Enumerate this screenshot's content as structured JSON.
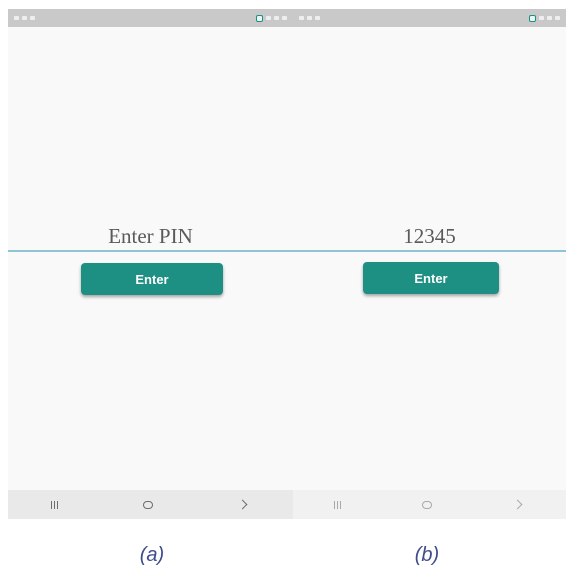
{
  "screens": [
    {
      "id": "a",
      "pin_field": {
        "placeholder": "Enter PIN",
        "value": ""
      },
      "enter_button": {
        "label": "Enter"
      },
      "caption": "(a)"
    },
    {
      "id": "b",
      "pin_field": {
        "placeholder": "Enter PIN",
        "value": "12345"
      },
      "enter_button": {
        "label": "Enter"
      },
      "caption": "(b)"
    }
  ],
  "nav_icons": [
    "recent-apps-icon",
    "home-icon",
    "back-icon"
  ],
  "colors": {
    "accent": "#1e8f83",
    "field_underline": "#8fc5d3",
    "caption": "#3f4d8c",
    "status_bar": "#c9c9c9"
  }
}
